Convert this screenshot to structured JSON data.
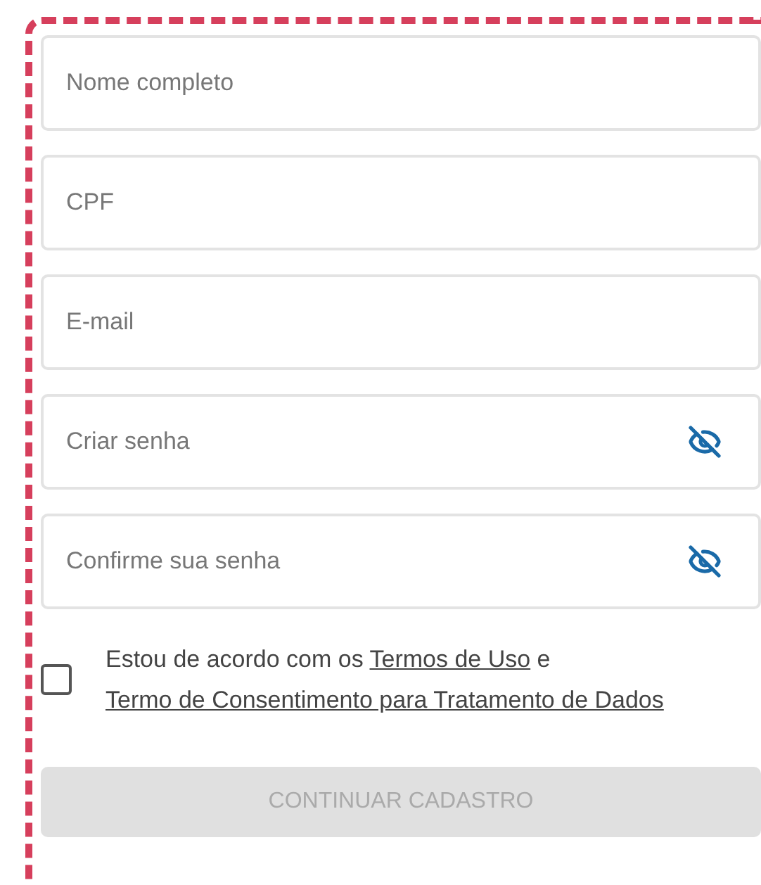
{
  "fields": [
    {
      "placeholder": "Nome completo",
      "kind": "text"
    },
    {
      "placeholder": "CPF",
      "kind": "text"
    },
    {
      "placeholder": "E-mail",
      "kind": "text"
    },
    {
      "placeholder": "Criar senha",
      "kind": "password"
    },
    {
      "placeholder": "Confirme sua senha",
      "kind": "password"
    }
  ],
  "agreement": {
    "checked": false,
    "parts": [
      {
        "kind": "text",
        "text": "Estou de acordo com os "
      },
      {
        "kind": "link",
        "text": "Termos de Uso"
      },
      {
        "kind": "text",
        "text": " e "
      },
      {
        "kind": "link",
        "text": "Termo de Consentimento para Tratamento de Dados"
      }
    ]
  },
  "submit": {
    "label": "CONTINUAR CADASTRO",
    "disabled": true
  }
}
